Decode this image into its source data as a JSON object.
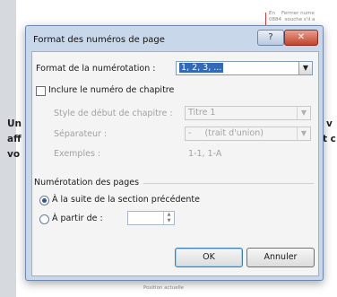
{
  "document": {
    "left_fragments": [
      "Un",
      "aff",
      "vo"
    ],
    "right_fragments": [
      "v",
      "t c"
    ],
    "top_fragment": "En    Fermer nume\n0884  souche s'il a",
    "bottom_fragment": "Position actuelle"
  },
  "dialog": {
    "title": "Format des numéros de page",
    "help_label": "?",
    "close_label": "✕",
    "number_format": {
      "label": "Format de la numérotation :",
      "value": "1, 2, 3, ..."
    },
    "include_chapter": {
      "label": "Inclure le numéro de chapitre",
      "checked": false
    },
    "chapter_style": {
      "label": "Style de début de chapitre :",
      "value": "Titre 1"
    },
    "separator": {
      "label": "Séparateur :",
      "value": "-     (trait d'union)"
    },
    "examples": {
      "label": "Exemples :",
      "value": "1-1, 1-A"
    },
    "page_numbering": {
      "group_label": "Numérotation des pages",
      "continue_option": "À la suite de la section précédente",
      "start_at_option": "À partir de :",
      "start_at_value": ""
    },
    "ok_label": "OK",
    "cancel_label": "Annuler"
  }
}
